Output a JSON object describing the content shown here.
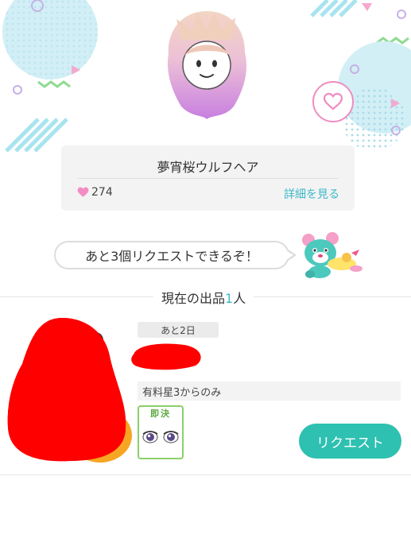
{
  "item": {
    "name": "夢宵桜ウルフヘア",
    "likes": "274",
    "details_link": "詳細を見る"
  },
  "request_bubble": {
    "text": "あと3個リクエストできるぞ！"
  },
  "section": {
    "title_prefix": "現在の出品",
    "count": "1",
    "title_suffix": "人"
  },
  "listing": {
    "remaining": "あと2日",
    "condition": "有料星3からのみ",
    "instant_label": "即決",
    "request_button": "リクエスト"
  },
  "colors": {
    "accent": "#2ec0b0",
    "link": "#3bb8c8",
    "heart": "#f08cc0",
    "redaction": "#ff0000"
  },
  "icons": {
    "heart_button": "heart-outline-icon",
    "likes": "heart-filled-icon"
  }
}
